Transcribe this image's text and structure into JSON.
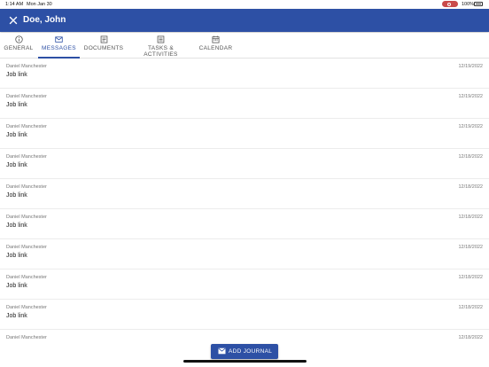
{
  "status_bar": {
    "time": "1:14 AM",
    "date": "Mon Jan 30",
    "battery": "100%"
  },
  "header": {
    "title": "Doe, John"
  },
  "tabs": [
    {
      "label": "GENERAL",
      "icon": "info-icon"
    },
    {
      "label": "MESSAGES",
      "icon": "mail-icon",
      "active": true
    },
    {
      "label": "DOCUMENTS",
      "icon": "document-icon"
    },
    {
      "label": "TASKS & ACTIVITIES",
      "icon": "tasks-icon"
    },
    {
      "label": "CALENDAR",
      "icon": "calendar-icon"
    }
  ],
  "messages": [
    {
      "from": "Daniel Manchester",
      "subject": "Job link",
      "date": "12/19/2022"
    },
    {
      "from": "Daniel Manchester",
      "subject": "Job link",
      "date": "12/19/2022"
    },
    {
      "from": "Daniel Manchester",
      "subject": "Job link",
      "date": "12/19/2022"
    },
    {
      "from": "Daniel Manchester",
      "subject": "Job link",
      "date": "12/18/2022"
    },
    {
      "from": "Daniel Manchester",
      "subject": "Job link",
      "date": "12/18/2022"
    },
    {
      "from": "Daniel Manchester",
      "subject": "Job link",
      "date": "12/18/2022"
    },
    {
      "from": "Daniel Manchester",
      "subject": "Job link",
      "date": "12/18/2022"
    },
    {
      "from": "Daniel Manchester",
      "subject": "Job link",
      "date": "12/18/2022"
    },
    {
      "from": "Daniel Manchester",
      "subject": "Job link",
      "date": "12/18/2022"
    },
    {
      "from": "Daniel Manchester",
      "subject": "",
      "date": "12/18/2022"
    }
  ],
  "fab": {
    "label": "ADD JOURNAL",
    "icon": "mail-icon"
  },
  "colors": {
    "primary": "#2d50a5"
  }
}
